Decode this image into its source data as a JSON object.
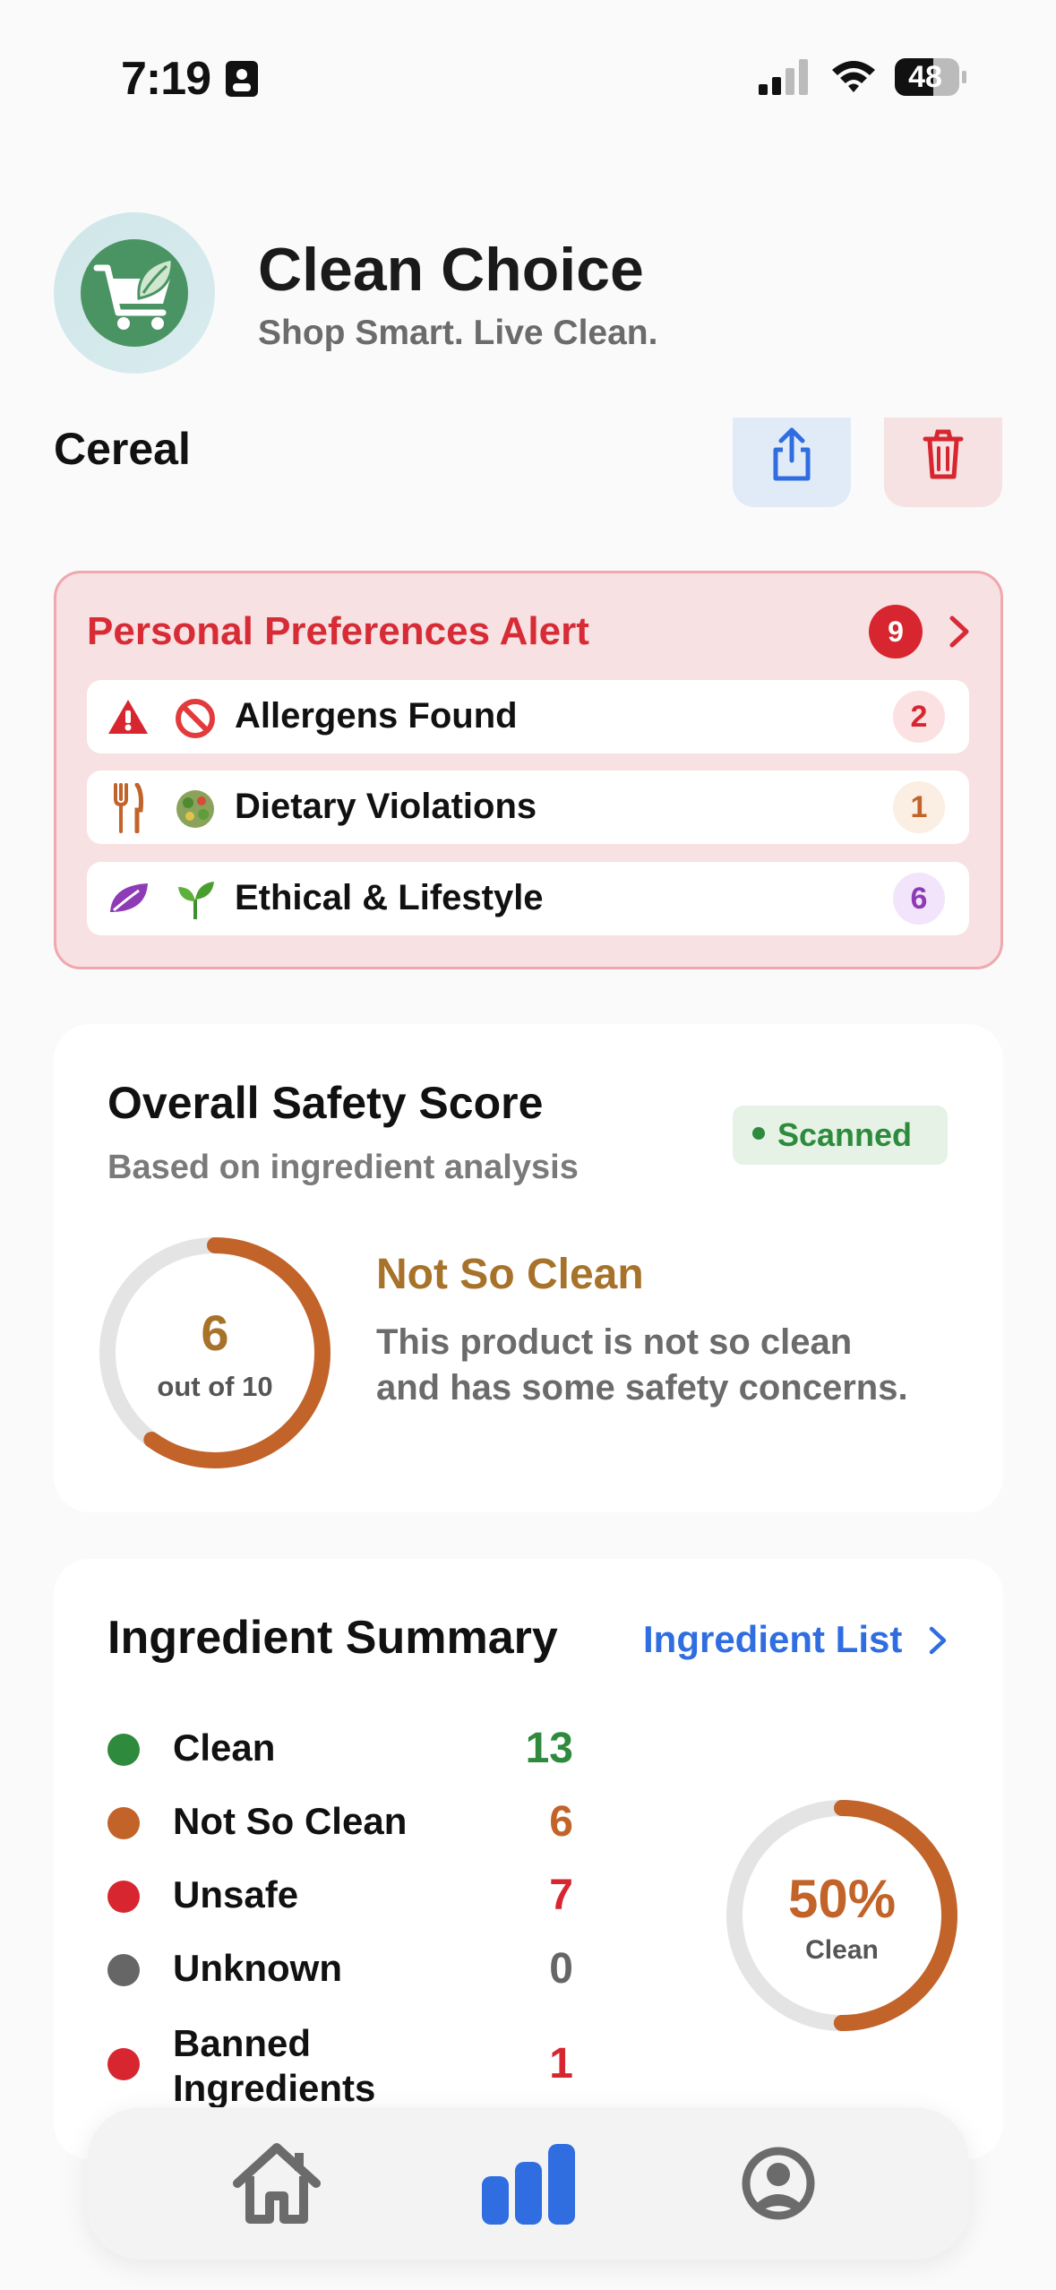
{
  "status_bar": {
    "time": "7:19",
    "battery": "48"
  },
  "header": {
    "title": "Clean Choice",
    "tagline": "Shop Smart. Live Clean."
  },
  "product": {
    "name": "Cereal"
  },
  "alert": {
    "title": "Personal Preferences Alert",
    "total": "9",
    "items": [
      {
        "label": "Allergens Found",
        "count": "2",
        "icon": "warning-icon",
        "emoji": "prohibited-icon",
        "color": "#d7262f"
      },
      {
        "label": "Dietary Violations",
        "count": "1",
        "icon": "fork-knife-icon",
        "emoji": "salad-icon",
        "color": "#c2632a"
      },
      {
        "label": "Ethical & Lifestyle",
        "count": "6",
        "icon": "leaf-icon",
        "emoji": "seedling-icon",
        "color": "#8e3bb5"
      }
    ]
  },
  "safety": {
    "title": "Overall Safety Score",
    "subtitle": "Based on ingredient analysis",
    "badge": "Scanned",
    "score": "6",
    "score_value": 6,
    "score_max_label": "out of 10",
    "status": "Not So Clean",
    "description": "This product is not so clean and has some safety concerns."
  },
  "summary": {
    "title": "Ingredient Summary",
    "link": "Ingredient List",
    "rows": [
      {
        "label": "Clean",
        "value": "13",
        "color": "#2e8a3c"
      },
      {
        "label": "Not So Clean",
        "value": "6",
        "color": "#c2632a"
      },
      {
        "label": "Unsafe",
        "value": "7",
        "color": "#d7262f"
      },
      {
        "label": "Unknown",
        "value": "0",
        "color": "#666666"
      },
      {
        "label": "Banned Ingredients",
        "value": "1",
        "color": "#d7262f"
      }
    ],
    "percent": "50%",
    "percent_value": 0.5,
    "percent_label": "Clean"
  },
  "tabs": [
    {
      "name": "home-icon"
    },
    {
      "name": "stats-icon",
      "active": true
    },
    {
      "name": "profile-icon"
    }
  ],
  "colors": {
    "accent_blue": "#2f6de0",
    "alert_red": "#d7262f",
    "warning_orange": "#c2632a",
    "clean_green": "#2e8a3c"
  }
}
